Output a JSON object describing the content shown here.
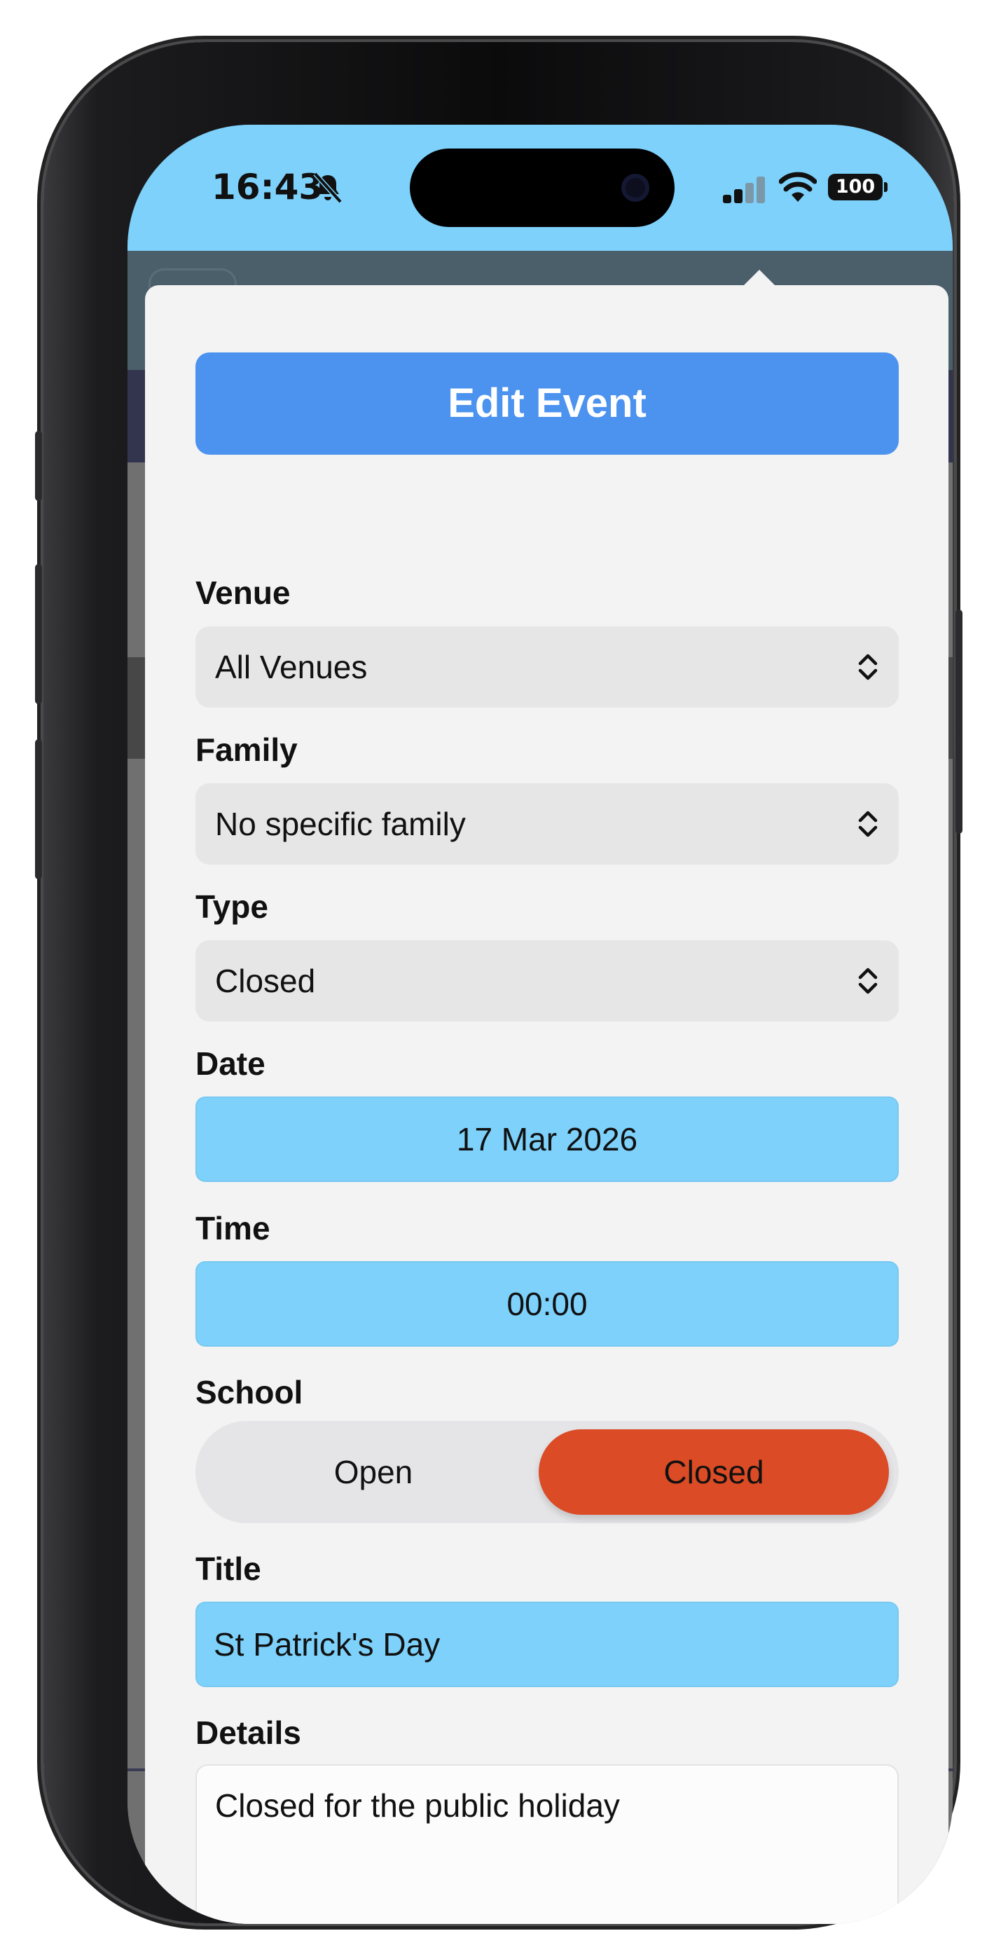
{
  "status_bar": {
    "time": "16:43",
    "battery": "100",
    "icons": [
      "bell-slash-icon",
      "cellular-signal-icon",
      "wifi-icon",
      "battery-icon"
    ]
  },
  "sheet": {
    "title": "Edit Event",
    "venue": {
      "label": "Venue",
      "value": "All Venues"
    },
    "family": {
      "label": "Family",
      "value": "No specific family"
    },
    "type": {
      "label": "Type",
      "value": "Closed"
    },
    "date": {
      "label": "Date",
      "value": "17 Mar 2026"
    },
    "time": {
      "label": "Time",
      "value": "00:00"
    },
    "school": {
      "label": "School",
      "options": [
        "Open",
        "Closed"
      ],
      "selected": "Closed"
    },
    "title_field": {
      "label": "Title",
      "value": "St Patrick's Day"
    },
    "details": {
      "label": "Details",
      "value": "Closed for the public holiday"
    }
  },
  "colors": {
    "accent": "#4c93ef",
    "field_fill": "#7dd1fb",
    "status_bar": "#7dd1fb",
    "selected_closed": "#db4b25",
    "sheet_bg": "#f3f3f3"
  }
}
